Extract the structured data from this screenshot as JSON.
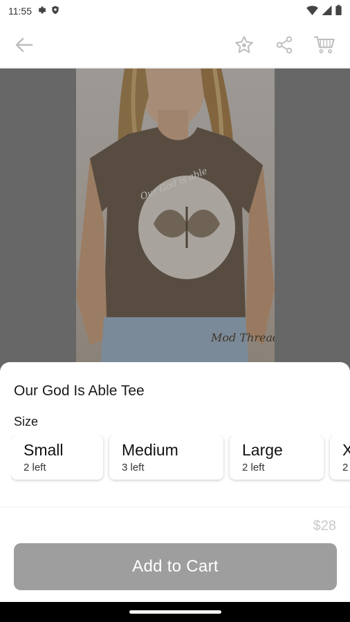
{
  "status_bar": {
    "time": "11:55",
    "icons": [
      "gear-icon",
      "shield-icon",
      "wifi-icon",
      "signal-icon",
      "battery-icon"
    ]
  },
  "toolbar": {
    "icons": [
      "back-arrow-icon",
      "star-icon",
      "share-icon",
      "cart-icon"
    ]
  },
  "product": {
    "title": "Our God Is Able Tee",
    "image_alt_text": "Our God is able",
    "watermark_text": "Mod Threads",
    "size_label": "Size",
    "sizes": [
      {
        "name": "Small",
        "stock": "2 left"
      },
      {
        "name": "Medium",
        "stock": "3 left"
      },
      {
        "name": "Large",
        "stock": "2 left"
      },
      {
        "name": "X",
        "stock": "2"
      }
    ],
    "price": "$28",
    "cta_label": "Add to Cart"
  },
  "colors": {
    "cta_background": "#9e9e9e",
    "price_text": "#c9c9c9",
    "shirt": "#7a6a5b"
  }
}
